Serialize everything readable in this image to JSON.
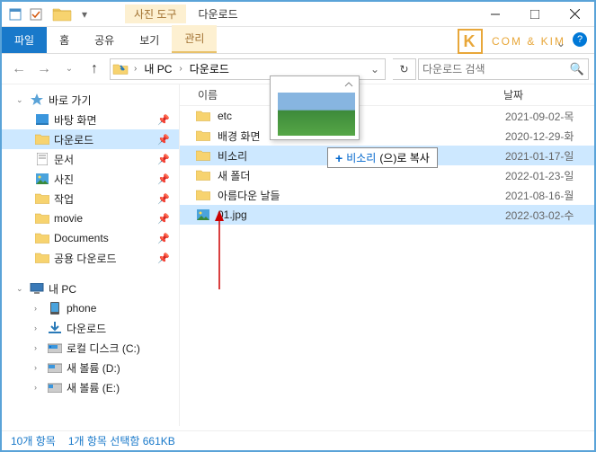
{
  "title": "다운로드",
  "ctx_tab": "사진 도구",
  "ribbon": {
    "file": "파일",
    "home": "홈",
    "share": "공유",
    "view": "보기",
    "manage": "관리"
  },
  "brand": "COM & KIM",
  "breadcrumb": {
    "seg1": "내 PC",
    "seg2": "다운로드"
  },
  "search_placeholder": "다운로드 검색",
  "columns": {
    "name": "이름",
    "date": "날짜"
  },
  "sidebar": {
    "quick": "바로 가기",
    "items": [
      "바탕 화면",
      "다운로드",
      "문서",
      "사진",
      "작업",
      "movie",
      "Documents",
      "공용 다운로드"
    ],
    "pc": "내 PC",
    "pc_items": [
      "phone",
      "다운로드",
      "로컬 디스크 (C:)",
      "새 볼륨 (D:)",
      "새 볼륨 (E:)"
    ]
  },
  "files": [
    {
      "name": "etc",
      "type": "folder",
      "date": "2021-09-02-목"
    },
    {
      "name": "배경 화면",
      "type": "folder",
      "date": "2020-12-29-화"
    },
    {
      "name": "비소리",
      "type": "folder",
      "date": "2021-01-17-일"
    },
    {
      "name": "새 폴더",
      "type": "folder",
      "date": "2022-01-23-일"
    },
    {
      "name": "아름다운 날들",
      "type": "folder",
      "date": "2021-08-16-월"
    },
    {
      "name": "01.jpg",
      "type": "image",
      "date": "2022-03-02-수"
    }
  ],
  "drag_tip": {
    "text": "(으)로 복사",
    "target": "비소리"
  },
  "status": {
    "count": "10개 항목",
    "sel": "1개 항목 선택함 661KB"
  }
}
